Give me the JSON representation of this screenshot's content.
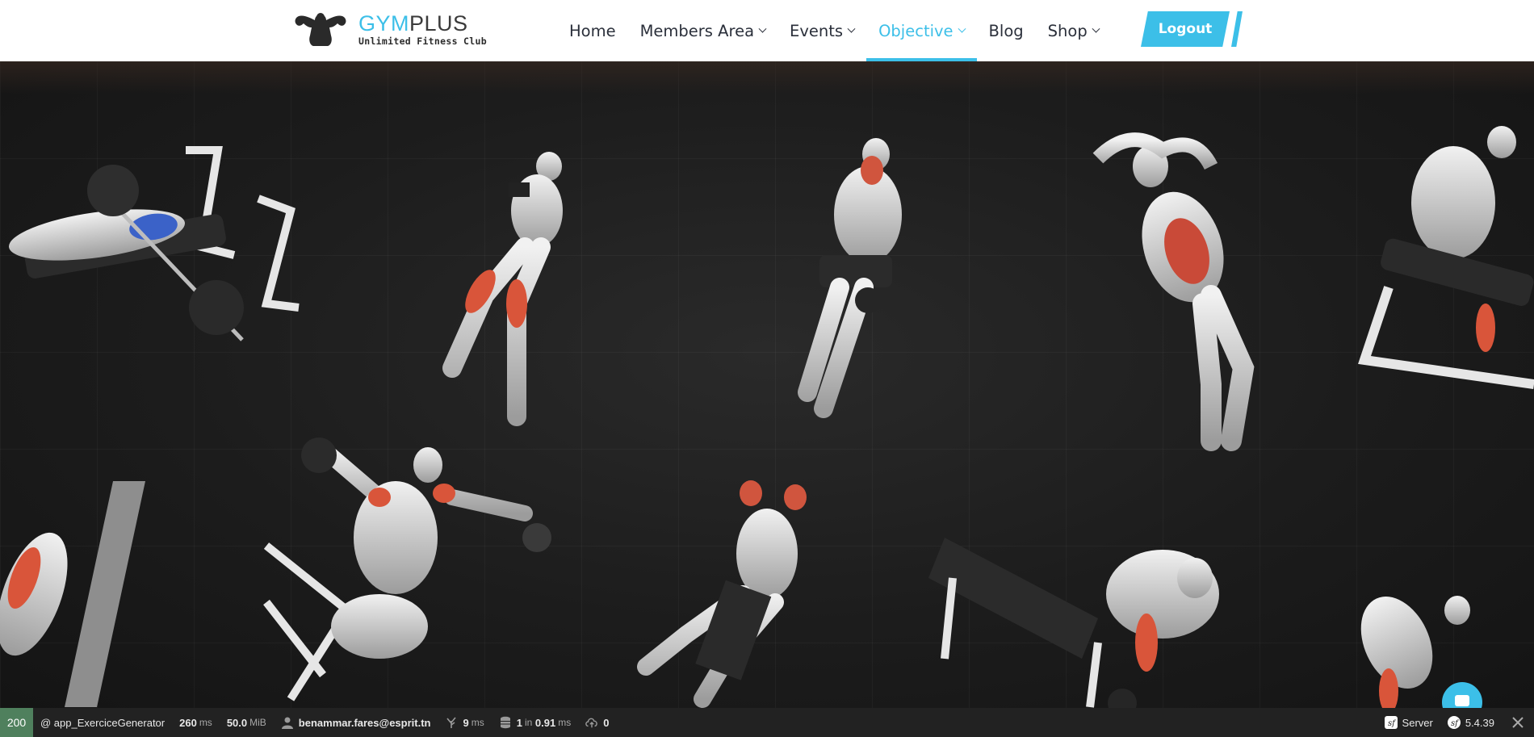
{
  "brand": {
    "name_part1": "GYM",
    "name_part2": "PLUS",
    "tagline": "Unlimited Fitness Club",
    "accent": "#3cbfe8"
  },
  "nav": {
    "items": [
      {
        "label": "Home"
      },
      {
        "label": "Members Area",
        "has_dropdown": true
      },
      {
        "label": "Events",
        "has_dropdown": true
      },
      {
        "label": "Objective",
        "has_dropdown": true,
        "active": true
      },
      {
        "label": "Blog"
      },
      {
        "label": "Shop",
        "has_dropdown": true
      }
    ],
    "logout_label": "Logout"
  },
  "hero": {
    "image": "exercise-illustrations-collage",
    "icon": "chat-bubble-icon"
  },
  "toolbar": {
    "status": "200",
    "route": "@ app_ExerciceGenerator",
    "time_value": "260",
    "time_unit": "ms",
    "memory_value": "50.0",
    "memory_unit": "MiB",
    "user": "benammar.fares@esprit.tn",
    "twig_value": "9",
    "twig_unit": "ms",
    "db_queries": "1",
    "db_in": "in",
    "db_time": "0.91",
    "db_unit": "ms",
    "cache_value": "0",
    "server_label": "Server",
    "version": "5.4.39",
    "status_color": "#4f805d"
  }
}
